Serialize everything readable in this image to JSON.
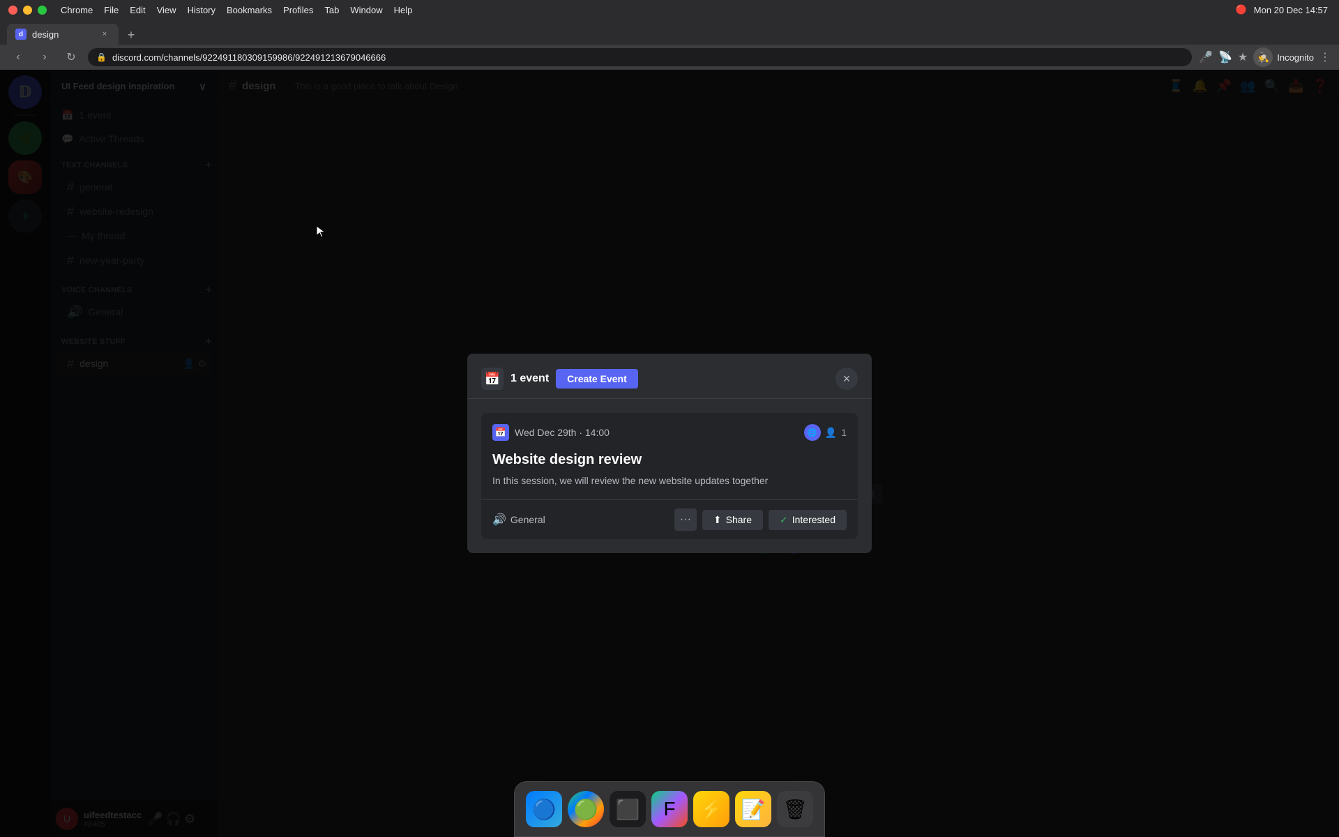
{
  "titlebar": {
    "traffic_close": "×",
    "traffic_min": "−",
    "traffic_max": "+",
    "menu_items": [
      "Chrome",
      "File",
      "Edit",
      "View",
      "History",
      "Bookmarks",
      "Profiles",
      "Tab",
      "Window",
      "Help"
    ],
    "battery_icon": "⚡",
    "time": "Mon 20 Dec  14:57",
    "clock_icon": "🔴"
  },
  "browser": {
    "tab_title": "design",
    "tab_favicon": "d",
    "new_tab_icon": "+",
    "url": "discord.com/channels/922491180309159986/922491213679046666",
    "incognito_label": "Incognito"
  },
  "discord": {
    "server_name": "UI Feed design inspiration",
    "channel_header": {
      "name": "design",
      "description": "This is a good place to talk about Design"
    },
    "sidebar": {
      "special_items": [
        {
          "icon": "📅",
          "label": "1 event"
        },
        {
          "icon": "💬",
          "label": "Active Threads"
        }
      ],
      "sections": [
        {
          "title": "TEXT CHANNELS",
          "channels": [
            {
              "icon": "#",
              "name": "general",
              "type": "text"
            },
            {
              "icon": "#",
              "name": "website-redesign",
              "type": "text"
            },
            {
              "icon": "—",
              "name": "My thread",
              "type": "thread"
            },
            {
              "icon": "#",
              "name": "new-year-party",
              "type": "text"
            }
          ]
        },
        {
          "title": "VOICE CHANNELS",
          "channels": [
            {
              "icon": "🔊",
              "name": "General",
              "type": "voice"
            }
          ]
        },
        {
          "title": "WEBSITE STUFF",
          "channels": [
            {
              "icon": "#",
              "name": "design",
              "type": "text",
              "active": true
            }
          ]
        }
      ]
    },
    "user_panel": {
      "name": "uifeedtestacc",
      "tag": "#8405",
      "avatar_letter": "U"
    }
  },
  "modal": {
    "title": "1 event",
    "create_event_label": "Create Event",
    "close_icon": "×",
    "event": {
      "date": "Wed Dec 29th · 14:00",
      "date_icon": "📅",
      "title": "Website design review",
      "description": "In this session, we will review the new website updates together",
      "attendee_count": "1",
      "location_icon": "🔊",
      "location": "General",
      "more_icon": "···",
      "share_icon": "⬆",
      "share_label": "Share",
      "interested_check": "✓",
      "interested_label": "Interested"
    }
  },
  "dock": {
    "icons": [
      {
        "name": "finder",
        "emoji": "🔵",
        "color": "blue"
      },
      {
        "name": "chrome",
        "emoji": "🟢",
        "color": "green2"
      },
      {
        "name": "terminal",
        "emoji": "⬛",
        "color": "dark"
      },
      {
        "name": "figma",
        "emoji": "🟣",
        "color": "purple"
      },
      {
        "name": "notes",
        "emoji": "📝",
        "color": "yellow"
      },
      {
        "name": "trash",
        "emoji": "🗑",
        "color": "dark"
      }
    ]
  }
}
